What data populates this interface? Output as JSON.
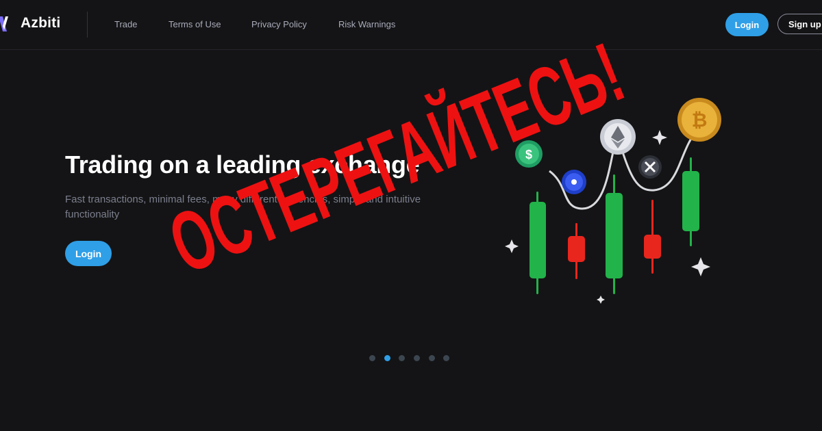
{
  "header": {
    "brand": "Azbiti",
    "nav": [
      {
        "label": "Trade"
      },
      {
        "label": "Terms of Use"
      },
      {
        "label": "Privacy Policy"
      },
      {
        "label": "Risk Warnings"
      }
    ],
    "login_label": "Login",
    "signup_label": "Sign up"
  },
  "hero": {
    "title": "Trading on a leading exchange",
    "subtitle": "Fast transactions, minimal fees, many different currencies, simple and intuitive functionality",
    "login_label": "Login"
  },
  "carousel": {
    "slide_count": 6,
    "active_index": 1
  },
  "overlay": {
    "stamp_text": "ОСТЕРЕГАЙТЕСЬ!"
  },
  "colors": {
    "background": "#141416",
    "accent": "#2f9fe7",
    "candle_up": "#22b34a",
    "candle_down": "#e8261d",
    "stamp": "#ee1111"
  },
  "icons": [
    "logo-icon",
    "coin-usdt-icon",
    "coin-eth-icon",
    "coin-bitcoin-icon",
    "coin-xrp-icon",
    "coin-cardano-icon",
    "sparkle-icon"
  ]
}
